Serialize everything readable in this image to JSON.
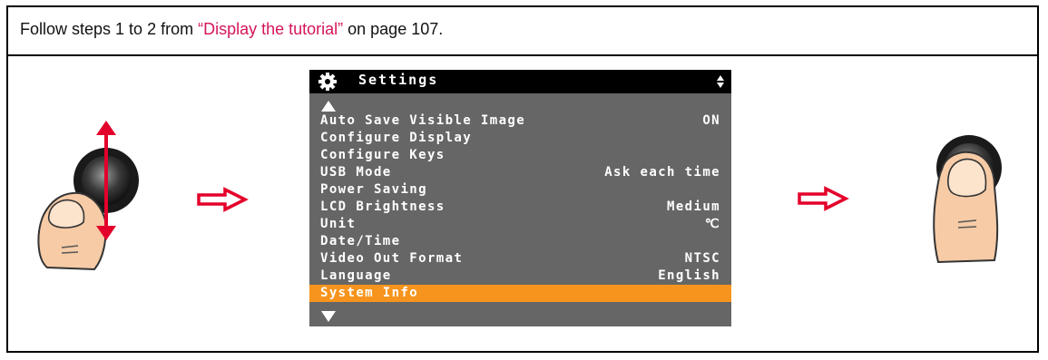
{
  "instruction": {
    "prefix": "Follow steps 1 to 2 from ",
    "link": "“Display the tutorial”",
    "suffix": " on page 107."
  },
  "colors": {
    "link": "#d4145a",
    "arrow": "#e3002a",
    "lcd_background": "#666666",
    "lcd_titlebar": "#000000",
    "lcd_selected": "#f7941d"
  },
  "left_figure": {
    "icon": "thumb-on-joystick-up-down-icon"
  },
  "step_arrows": {
    "icon": "outlined-right-arrow-icon"
  },
  "right_figure": {
    "icon": "thumb-pressing-joystick-icon"
  },
  "screen": {
    "title": "Settings",
    "title_icon": "gear-icon",
    "titlebar_indicator_icon": "up-down-indicator-icon",
    "scroll_up_icon": "scroll-up-icon",
    "scroll_down_icon": "scroll-down-icon",
    "items": [
      {
        "label": "Auto Save Visible Image",
        "value": "ON"
      },
      {
        "label": "Configure Display",
        "value": ""
      },
      {
        "label": "Configure Keys",
        "value": ""
      },
      {
        "label": "USB Mode",
        "value": "Ask each time"
      },
      {
        "label": "Power Saving",
        "value": ""
      },
      {
        "label": "LCD Brightness",
        "value": "Medium"
      },
      {
        "label": "Unit",
        "value": "℃"
      },
      {
        "label": "Date/Time",
        "value": ""
      },
      {
        "label": "Video Out Format",
        "value": "NTSC"
      },
      {
        "label": "Language",
        "value": "English"
      },
      {
        "label": "System Info",
        "value": "",
        "selected": true
      }
    ]
  }
}
